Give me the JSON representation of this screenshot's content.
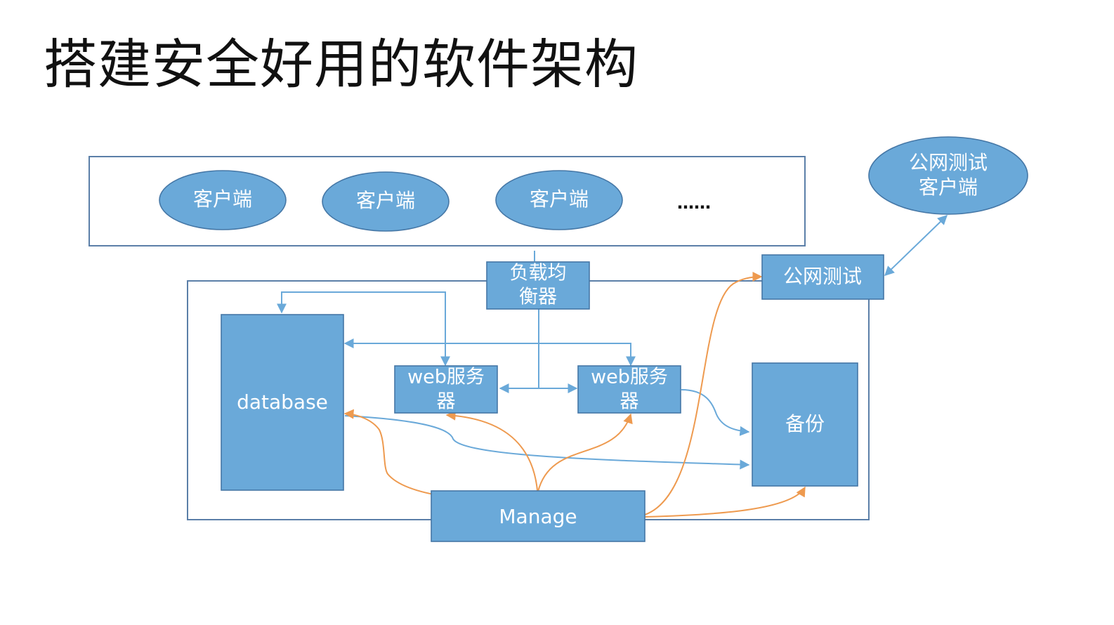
{
  "title": "搭建安全好用的软件架构",
  "clients": {
    "client1": "客户端",
    "client2": "客户端",
    "client3": "客户端",
    "more": "……"
  },
  "public_test_client": {
    "line1": "公网测试",
    "line2": "客户端"
  },
  "load_balancer": {
    "line1": "负载均",
    "line2": "衡器"
  },
  "public_test": "公网测试",
  "database": "database",
  "web_server_1": {
    "line1": "web服务",
    "line2": "器"
  },
  "web_server_2": {
    "line1": "web服务",
    "line2": "器"
  },
  "backup": "备份",
  "manage": "Manage",
  "colors": {
    "node_fill": "#6aa9d9",
    "node_border": "#4577a6",
    "frame_border": "#5b7fa8",
    "blue_arrow": "#6aa9d9",
    "orange_arrow": "#ee9a4f"
  }
}
